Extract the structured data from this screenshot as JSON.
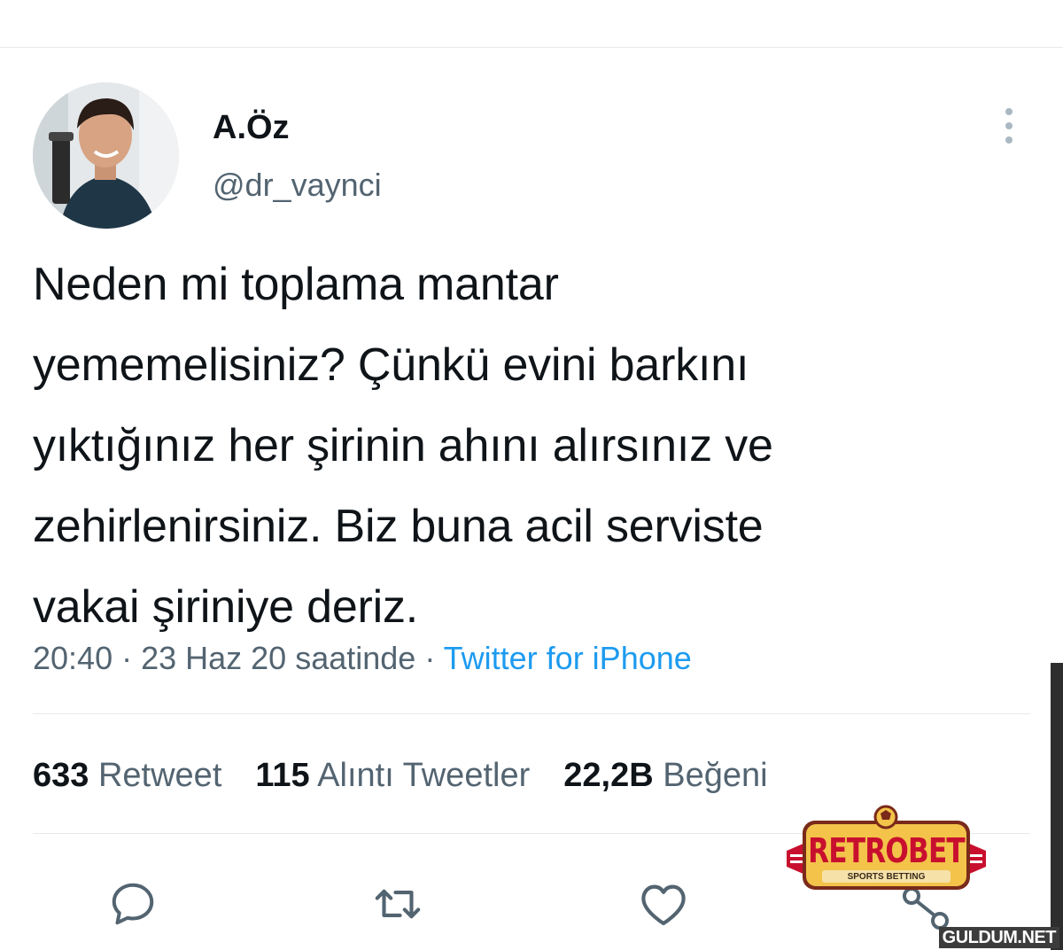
{
  "tweet": {
    "author": {
      "display_name": "A.Öz",
      "username": "@dr_vaynci"
    },
    "text": "Neden mi toplama mantar\nyememelisiniz? Çünkü evini barkını\nyıktığınız her şirinin ahını alırsınız ve\nzehirlenirsiniz. Biz buna acil serviste\nvakai şiriniye deriz.",
    "meta": {
      "time": "20:40",
      "separator": " · ",
      "date": "23 Haz 20 saatinde",
      "source": "Twitter for iPhone"
    },
    "stats": [
      {
        "number": "633",
        "label": "Retweet"
      },
      {
        "number": "115",
        "label": "Alıntı Tweetler"
      },
      {
        "number": "22,2B",
        "label": "Beğeni"
      }
    ]
  },
  "actions": {
    "reply_icon": "reply-icon",
    "retweet_icon": "retweet-icon",
    "like_icon": "heart-icon",
    "share_icon": "share-icon"
  },
  "watermark": {
    "brand": "RETROBET",
    "tagline": "SPORTS BETTING",
    "site": "GULDUM.NET"
  },
  "colors": {
    "text": "#0f1419",
    "secondary": "#536471",
    "link": "#1d9bf0",
    "divider": "#e6e9ec",
    "brand_red": "#c8102e",
    "brand_gold": "#f3c34a"
  }
}
